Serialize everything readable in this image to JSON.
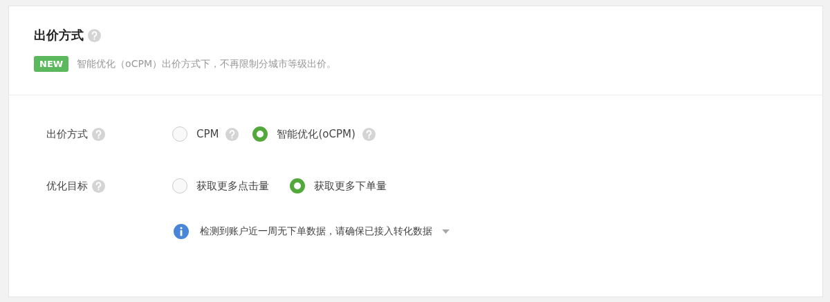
{
  "header": {
    "title": "出价方式",
    "badge": "NEW",
    "notice": "智能优化（oCPM）出价方式下，不再限制分城市等级出价。"
  },
  "rows": [
    {
      "label": "出价方式",
      "options": [
        {
          "label": "CPM",
          "selected": false,
          "help": true
        },
        {
          "label": "智能优化(oCPM)",
          "selected": true,
          "help": true
        }
      ]
    },
    {
      "label": "优化目标",
      "options": [
        {
          "label": "获取更多点击量",
          "selected": false,
          "help": false
        },
        {
          "label": "获取更多下单量",
          "selected": true,
          "help": false
        }
      ]
    }
  ],
  "info": {
    "text": "检测到账户近一周无下单数据，请确保已接入转化数据",
    "expanded": false
  }
}
